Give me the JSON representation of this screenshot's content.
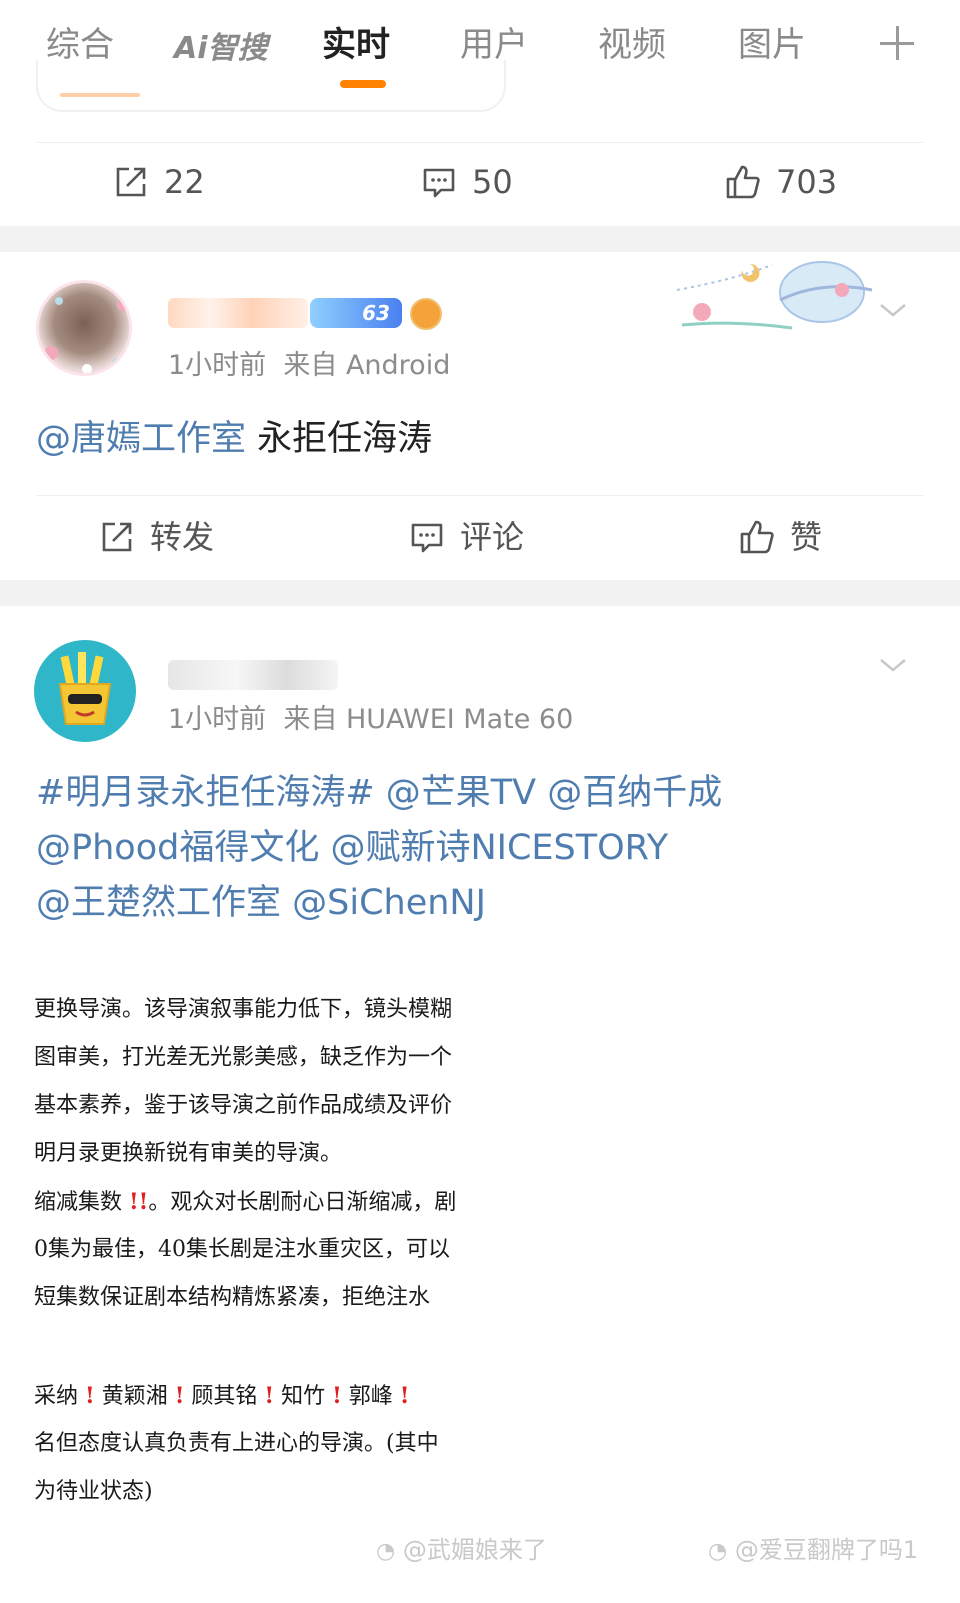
{
  "tabs": [
    {
      "label": "综合"
    },
    {
      "label": "Ai智搜"
    },
    {
      "label": "实时"
    },
    {
      "label": "用户"
    },
    {
      "label": "视频"
    },
    {
      "label": "图片"
    }
  ],
  "active_tab": "实时",
  "colors": {
    "accent": "#ff8200",
    "link": "#507daf",
    "gap": "#f2f2f2"
  },
  "prev_post": {
    "repost_count": "22",
    "comment_count": "50",
    "like_count": "703"
  },
  "post1": {
    "time": "1小时前",
    "source": "来自 Android",
    "level_badge": "63",
    "mention": "@唐嫣工作室",
    "text": " 永拒任海涛",
    "actions": {
      "repost": "转发",
      "comment": "评论",
      "like": "赞"
    }
  },
  "post2": {
    "time": "1小时前",
    "source": "来自 HUAWEI Mate 60",
    "line1": "#明月录永拒任海涛# @芒果TV @百纳千成",
    "line2": "@Phood福得文化 @赋新诗NICESTORY",
    "line3": "@王楚然工作室 @SiChenNJ",
    "image_lines": [
      "更换导演。该导演叙事能力低下，镜头模糊",
      "图审美，打光差无光影美感，缺乏作为一个",
      "基本素养，鉴于该导演之前作品成绩及评价",
      "明月录更换新锐有审美的导演。",
      "缩减集数",
      "。观众对长剧耐心日渐缩减，剧",
      "0集为最佳，40集长剧是注水重灾区，可以",
      "短集数保证剧本结构精炼紧凑，拒绝注水",
      "采纳",
      "黄颖湘",
      "顾其铭",
      "知竹",
      "郭峰",
      "名但态度认真负责有上进心的导演。(其中",
      "为待业状态)"
    ]
  },
  "watermarks": [
    "@武媚娘来了",
    "@爱豆翻牌了吗1"
  ]
}
